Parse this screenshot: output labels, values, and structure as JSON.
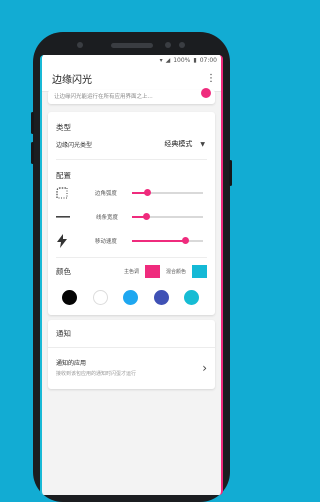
{
  "app": {
    "title": "边缘闪光",
    "more_icon": "⋮"
  },
  "status_bar": {
    "battery": "100%",
    "time": "07:00"
  },
  "top_card": {
    "description": "让边缘闪光能运行在所有应用界面之上..."
  },
  "type_section": {
    "title": "类型",
    "label": "边缘闪光类型",
    "selected": "经典模式"
  },
  "config_section": {
    "title": "配置",
    "sliders": [
      {
        "label": "边角弧度",
        "value": 0.22
      },
      {
        "label": "线条宽度",
        "value": 0.2
      },
      {
        "label": "移动速度",
        "value": 0.75
      }
    ]
  },
  "color_section": {
    "title": "颜色",
    "primary_label": "主色调",
    "primary_color": "#ef2b7d",
    "mix_label": "混合颜色",
    "mix_color": "#14b9d6",
    "palette": [
      "#050505",
      "#ffffff",
      "#1ea7f0",
      "#3f51b5",
      "#16bcd4"
    ]
  },
  "notify_section": {
    "title": "通知",
    "item_title": "通知的应用",
    "item_desc": "接收到该包应用的通知时闪蛋才运行"
  }
}
